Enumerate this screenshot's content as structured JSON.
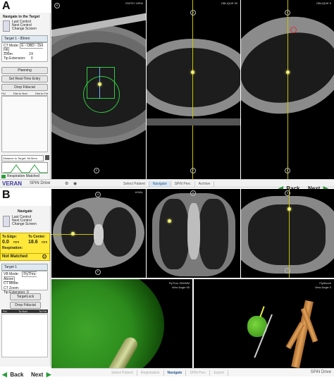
{
  "panel_a": {
    "letter": "A",
    "sidebar": {
      "navigate_title": "Navigate to the Target",
      "legend": [
        "Last Control",
        "Next Control",
        "Change Screen"
      ],
      "target_label": "Target 1 - 89mm",
      "ct_mode_label": "CT Mode:",
      "ct_mode_value": "E - OBD - Dot Fill",
      "zoom_label": "Zoom",
      "zoom_value": "2X",
      "tip_ext_label": "Tip Extension:",
      "tip_ext_value": "0",
      "planning": "Planning",
      "set_real_time": "Set Real-Time Entry",
      "drop_fiducial": "Drop Fiducial",
      "fid_row": [
        "Fid",
        "Dist to Nod",
        "Dist to Fid"
      ],
      "distance_label": "Distance to Target: 56.5mm",
      "respiration": "Respiration Matched"
    },
    "views": {
      "view1_tag": "ENTRY VIEW",
      "view2_tag": "OBLIQUE 90",
      "view3_tag": "OBLIQUE 0"
    },
    "statusbar": {
      "brand": "VERAN",
      "product": "SPiN Drive",
      "tabs": [
        "Select Patient",
        "Navigate",
        "SPiN Perc",
        "Archive"
      ],
      "active_tab": "Navigate",
      "back": "Back",
      "next": "Next"
    }
  },
  "panel_b": {
    "letter": "B",
    "sidebar": {
      "navigate_title": "Navigate",
      "legend": [
        "Last Control",
        "Next Control",
        "Change Screen"
      ],
      "to_edge_label": "To Edge:",
      "to_edge_value": "0.0",
      "to_edge_unit": "mm",
      "to_center_label": "To Center:",
      "to_center_value": "18.6",
      "to_center_unit": "mm",
      "respiration_label": "Respiration:",
      "respiration_value": "Not Matched",
      "target_label": "Target 1",
      "vb_mode_label": "VB Mode:",
      "vb_mode_value": "FlyThru-Above",
      "ct_mode_label": "CT Mode:",
      "ct_zoom_label": "CT Zoom:",
      "tip_ext_label": "Tip Extension:",
      "tip_ext_value": "0",
      "target_lock": "TargetLock",
      "drop_fiducial": "Drop Fiducial",
      "fid_row": [
        "Fid",
        "To Nod",
        "To Fid"
      ],
      "back": "Back",
      "next": "Next"
    },
    "views": {
      "axial_tag": "AXIAL",
      "fly1_tag": "FlyThru GM/WM",
      "fly1_angle": "View Angle 95",
      "fly2_tag": "FlyAbove",
      "fly2_angle": "View Angle 0"
    },
    "footer": {
      "tabs": [
        "Select Patient",
        "Registration",
        "Navigate",
        "SPiN Perc",
        "Export"
      ],
      "active_tab": "Navigate",
      "product": "SPiN Drive"
    }
  },
  "colors": {
    "accent_yellow": "#ffe83a",
    "target_green": "#2ecc40",
    "nav_arrow": "#2a9d3a",
    "active_tab": "#2a5b8c"
  }
}
